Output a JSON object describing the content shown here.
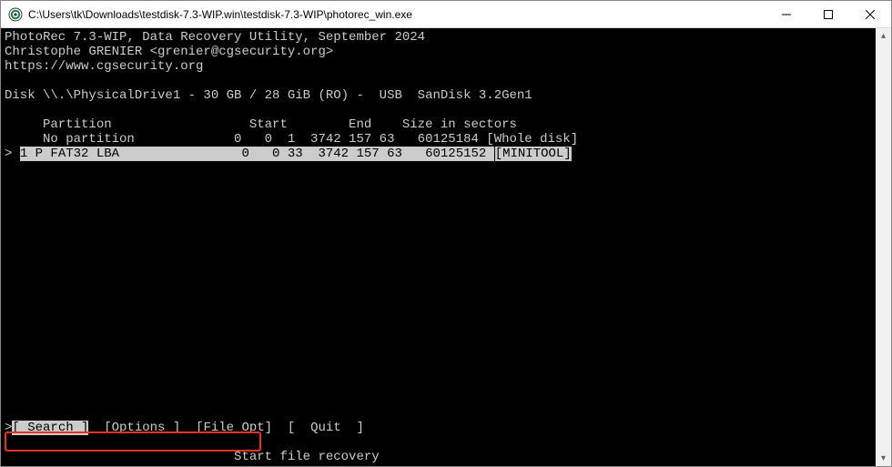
{
  "titlebar": {
    "path": "C:\\Users\\tk\\Downloads\\testdisk-7.3-WIP.win\\testdisk-7.3-WIP\\photorec_win.exe"
  },
  "window_controls": {
    "minimize": "Minimize",
    "maximize": "Maximize",
    "close": "Close"
  },
  "header": {
    "line1": "PhotoRec 7.3-WIP, Data Recovery Utility, September 2024",
    "line2": "Christophe GRENIER <grenier@cgsecurity.org>",
    "line3": "https://www.cgsecurity.org"
  },
  "disk_line": "Disk \\\\.\\PhysicalDrive1 - 30 GB / 28 GiB (RO) -  USB  SanDisk 3.2Gen1",
  "table": {
    "header": "     Partition                  Start        End    Size in sectors",
    "row0": "     No partition             0   0  1  3742 157 63   60125184 ",
    "row0_tag": "[Whole disk]",
    "row1_pre": "> ",
    "row1": "1 P FAT32 LBA                0   0 33  3742 157 63   60125152 ",
    "row1_tag": "[MINITOOL]"
  },
  "menu": {
    "prompt_mark": ">",
    "search": "[ Search ]",
    "options": "[Options ]",
    "fileopt": "[File Opt]",
    "quit": "[  Quit  ]",
    "hint": "                              Start file recovery"
  }
}
